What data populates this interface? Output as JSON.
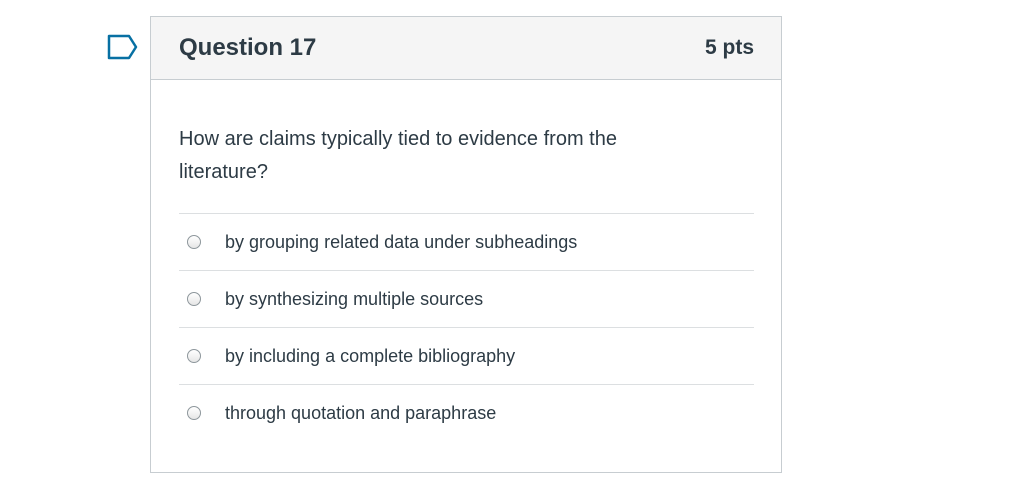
{
  "question": {
    "title": "Question 17",
    "points": "5 pts",
    "text": "How are claims typically tied to evidence from the literature?",
    "answers": [
      "by grouping related data under subheadings",
      "by synthesizing multiple sources",
      "by including a complete bibliography",
      "through quotation and paraphrase"
    ]
  },
  "icons": {
    "flag": "flag-question-icon"
  },
  "colors": {
    "text": "#2d3b45",
    "header_bg": "#f5f5f5",
    "border": "#c7cdd1",
    "flag": "#0770a3"
  }
}
